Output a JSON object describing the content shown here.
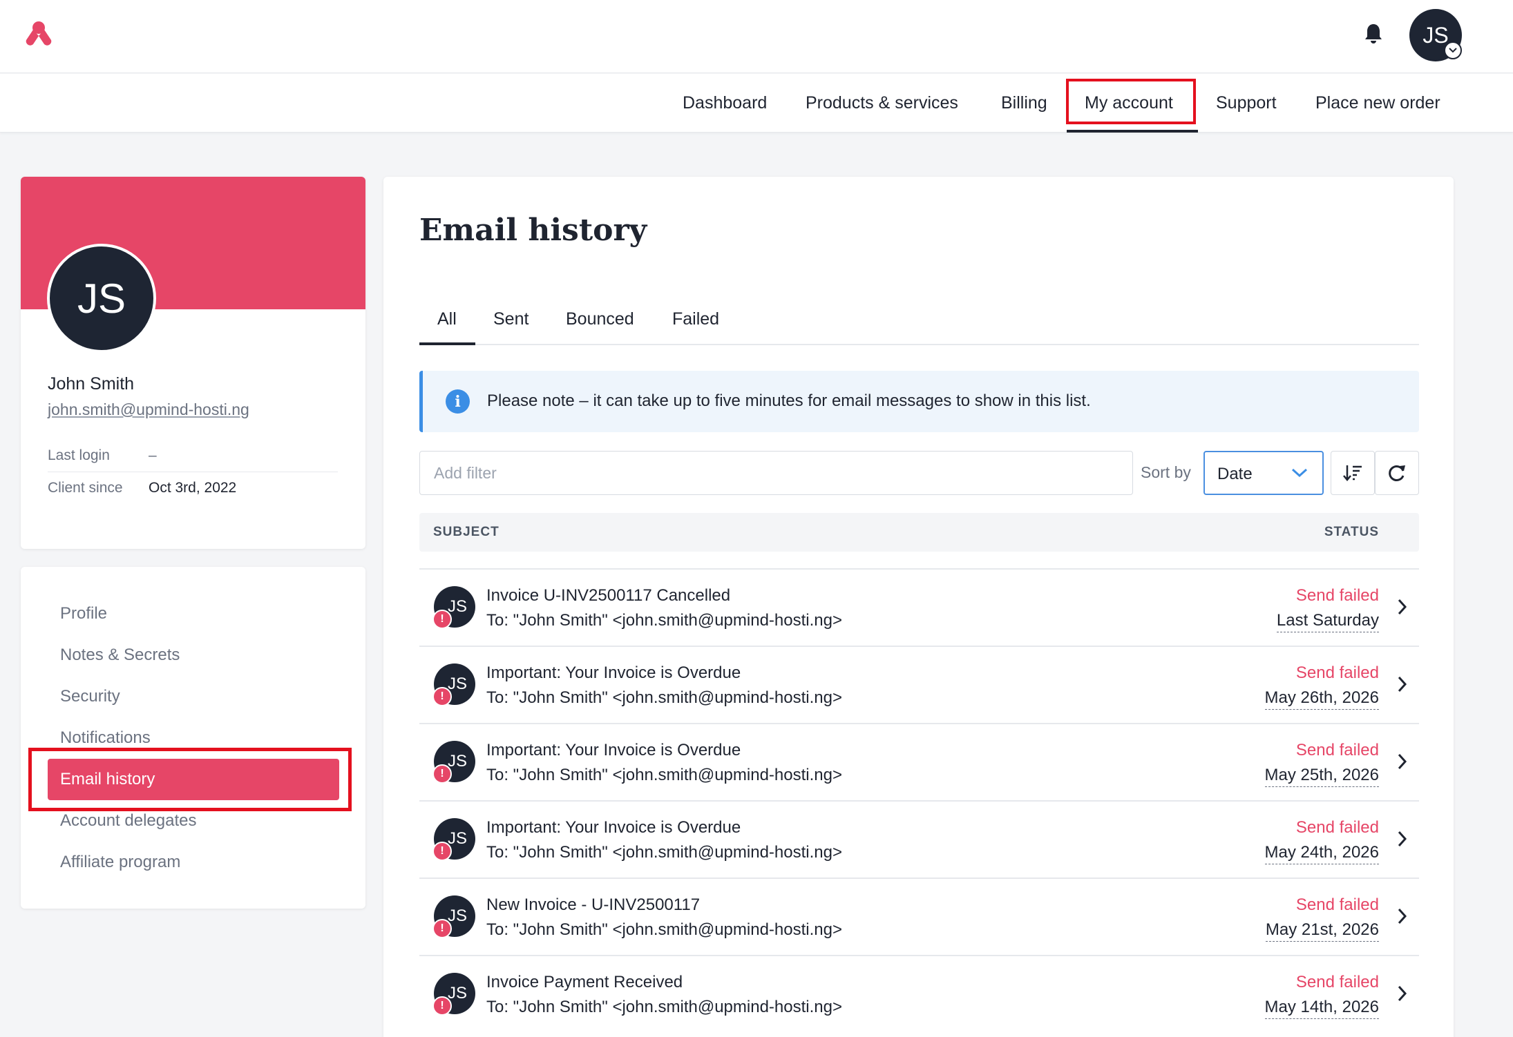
{
  "brand": {
    "accent": "#e64667",
    "dark": "#1e2533",
    "highlight": "#e4101e",
    "info": "#3b8ee5",
    "logo_icon": "upmind-logo-icon"
  },
  "header": {
    "avatar_initials": "JS",
    "bell_icon": "bell-icon"
  },
  "nav": {
    "items": [
      {
        "label": "Dashboard"
      },
      {
        "label": "Products & services"
      },
      {
        "label": "Billing"
      },
      {
        "label": "My account",
        "active": true
      },
      {
        "label": "Support"
      },
      {
        "label": "Place new order"
      }
    ]
  },
  "profile": {
    "initials": "JS",
    "name": "John Smith",
    "email": "john.smith@upmind-hosti.ng",
    "last_login_label": "Last login",
    "last_login_value": "–",
    "client_since_label": "Client since",
    "client_since_value": "Oct 3rd, 2022"
  },
  "side_menu": {
    "items": [
      {
        "label": "Profile"
      },
      {
        "label": "Notes & Secrets"
      },
      {
        "label": "Security"
      },
      {
        "label": "Notifications"
      },
      {
        "label": "Email history",
        "active": true
      },
      {
        "label": "Account delegates"
      },
      {
        "label": "Affiliate program"
      }
    ]
  },
  "main": {
    "title": "Email history",
    "tabs": [
      {
        "label": "All",
        "active": true
      },
      {
        "label": "Sent"
      },
      {
        "label": "Bounced"
      },
      {
        "label": "Failed"
      }
    ],
    "notice": "Please note – it can take up to five minutes for email messages to show in this list.",
    "filter_placeholder": "Add filter",
    "sort_label": "Sort by",
    "sort_value": "Date",
    "columns": {
      "subject": "SUBJECT",
      "status": "STATUS"
    },
    "rows": [
      {
        "avatar": "JS",
        "subject": "Invoice U-INV2500117 Cancelled",
        "to": "To: \"John Smith\" <john.smith@upmind-hosti.ng>",
        "status": "Send failed",
        "date": "Last Saturday"
      },
      {
        "avatar": "JS",
        "subject": "Important: Your Invoice is Overdue",
        "to": "To: \"John Smith\" <john.smith@upmind-hosti.ng>",
        "status": "Send failed",
        "date": "May 26th, 2026"
      },
      {
        "avatar": "JS",
        "subject": "Important: Your Invoice is Overdue",
        "to": "To: \"John Smith\" <john.smith@upmind-hosti.ng>",
        "status": "Send failed",
        "date": "May 25th, 2026"
      },
      {
        "avatar": "JS",
        "subject": "Important: Your Invoice is Overdue",
        "to": "To: \"John Smith\" <john.smith@upmind-hosti.ng>",
        "status": "Send failed",
        "date": "May 24th, 2026"
      },
      {
        "avatar": "JS",
        "subject": "New Invoice - U-INV2500117",
        "to": "To: \"John Smith\" <john.smith@upmind-hosti.ng>",
        "status": "Send failed",
        "date": "May 21st, 2026"
      },
      {
        "avatar": "JS",
        "subject": "Invoice Payment Received",
        "to": "To: \"John Smith\" <john.smith@upmind-hosti.ng>",
        "status": "Send failed",
        "date": "May 14th, 2026"
      }
    ]
  }
}
